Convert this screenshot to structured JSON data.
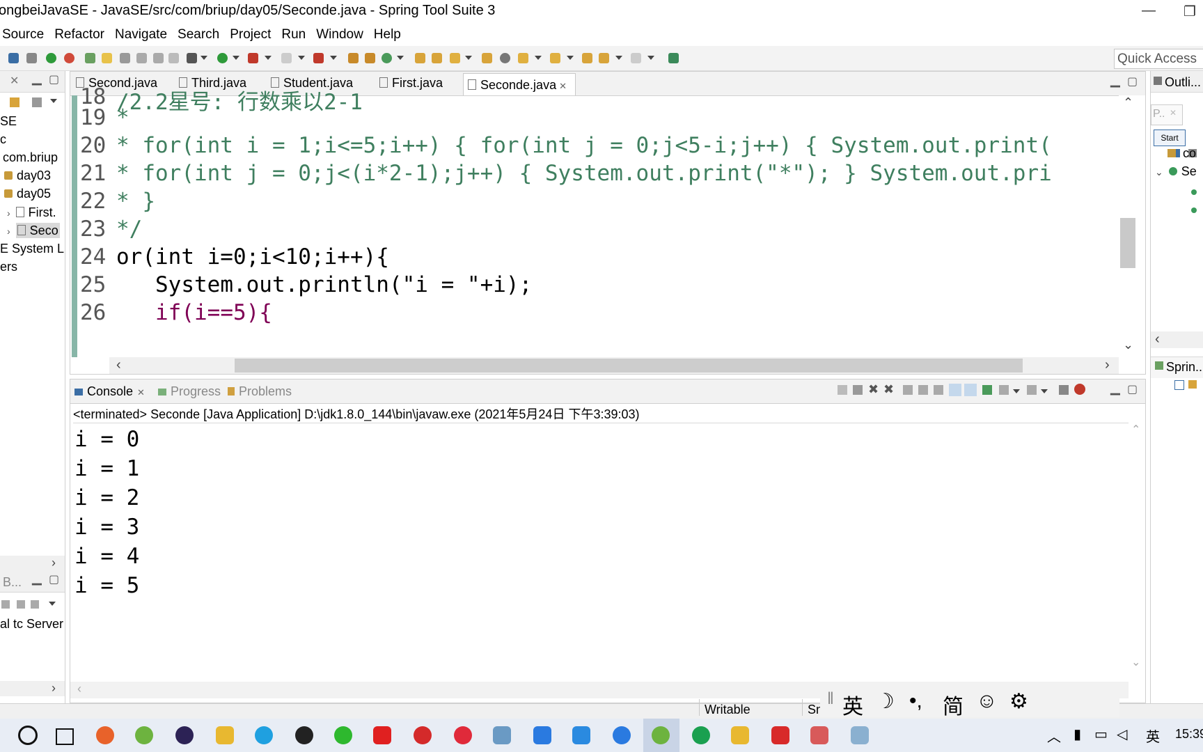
{
  "window": {
    "title": "ongbeiJavaSE - JavaSE/src/com/briup/day05/Seconde.java - Spring Tool Suite 3"
  },
  "menu": [
    "Source",
    "Refactor",
    "Navigate",
    "Search",
    "Project",
    "Run",
    "Window",
    "Help"
  ],
  "toolbar": {
    "quick_access": "Quick Access"
  },
  "explorer": {
    "items": [
      "SE",
      "c",
      "com.briup",
      "day03",
      "day05",
      "First.",
      "Seco",
      "E System Li",
      "ers"
    ]
  },
  "servers": {
    "tab": "B...",
    "item": "al tc Server"
  },
  "editor": {
    "tabs": [
      "Second.java",
      "Third.java",
      "Student.java",
      "First.java",
      "Seconde.java"
    ],
    "active_tab": "Seconde.java",
    "lines": [
      {
        "n": "18",
        "text": "/2.2星号: 行数乘以2-1"
      },
      {
        "n": "19",
        "text": "*"
      },
      {
        "n": "20",
        "text": "* for(int i = 1;i<=5;i++) { for(int j = 0;j<5-i;j++) { System.out.print("
      },
      {
        "n": "21",
        "text": "* for(int j = 0;j<(i*2-1);j++) { System.out.print(\"*\"); } System.out.pri"
      },
      {
        "n": "22",
        "text": "* }"
      },
      {
        "n": "23",
        "text": "*/"
      },
      {
        "n": "24",
        "text": "or(int i=0;i<10;i++){"
      },
      {
        "n": "25",
        "text": "System.out.println(\"i = \"+i);"
      },
      {
        "n": "26",
        "text": "if(i==5){"
      }
    ]
  },
  "console": {
    "tabs": [
      "Console",
      "Progress",
      "Problems"
    ],
    "status": "<terminated> Seconde [Java Application] D:\\jdk1.8.0_144\\bin\\javaw.exe (2021年5月24日 下午3:39:03)",
    "output": [
      "i = 0",
      "i = 1",
      "i = 2",
      "i = 3",
      "i = 4",
      "i = 5"
    ]
  },
  "outline": {
    "title": "Outli...",
    "button": "Start",
    "p": "P..",
    "items": [
      "co",
      "Se"
    ],
    "spring": "Sprin..."
  },
  "statusbar": {
    "writable": "Writable",
    "smart": "Sn"
  },
  "ime": {
    "lang": "英",
    "moon": "☽",
    "punct": "•,",
    "simp": "简",
    "emoji": "☺",
    "settings": "⚙"
  },
  "taskbar": {
    "tray_lang": "英",
    "clock": "15:39"
  },
  "colors": {
    "comment": "#3f7f5f",
    "keyword": "#7f0055",
    "field": "#0000c0",
    "string": "#2a00ff"
  }
}
